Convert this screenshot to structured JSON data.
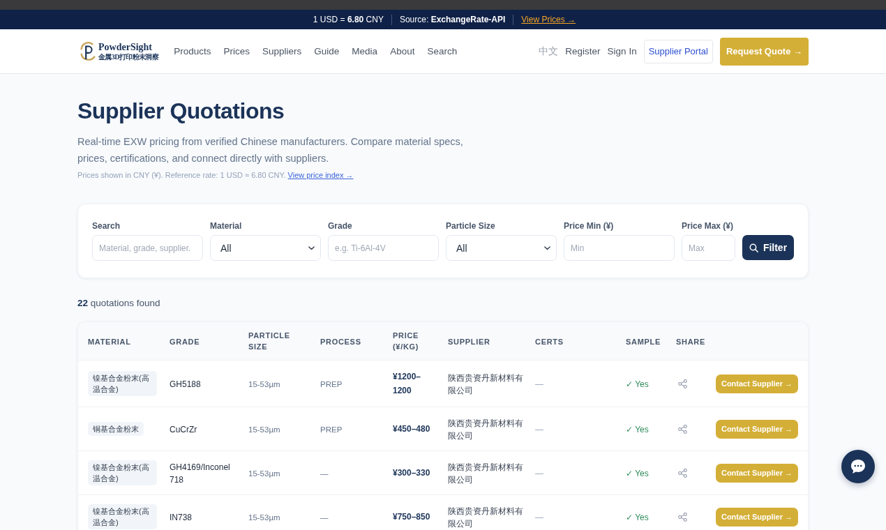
{
  "rate_bar": {
    "rate": "1 USD = **6.80** CNY",
    "source": "Source: **ExchangeRate-API**",
    "link": "View Prices →"
  },
  "header": {
    "logo": {
      "name": "PowderSight",
      "tagline": "金属3D打印粉末洞察"
    },
    "nav": [
      "Products",
      "Prices",
      "Suppliers",
      "Guide",
      "Media",
      "About",
      "Search"
    ],
    "language": "中文",
    "links": [
      "Register",
      "Sign In"
    ],
    "supplier_portal": "Supplier Portal",
    "request_quote": "Request Quote →"
  },
  "intro": {
    "title": "Supplier Quotations",
    "description": "Real-time EXW pricing from verified Chinese manufacturers. Compare material specs, prices, certifications, and connect directly with suppliers.",
    "note": "Prices shown in CNY (¥). Reference rate: 1 USD ≈ 6.80 CNY.",
    "note_link": "View price index →"
  },
  "filters": {
    "fields": [
      {
        "kind": "text",
        "label": "Search",
        "placeholder": "Material, grade, supplier."
      },
      {
        "kind": "select",
        "label": "Material",
        "value": "All"
      },
      {
        "kind": "text",
        "label": "Grade",
        "placeholder": "e.g. Ti-6Al-4V"
      },
      {
        "kind": "select",
        "label": "Particle Size",
        "value": "All"
      },
      {
        "kind": "text",
        "label": "Price Min (¥)",
        "placeholder": "Min"
      },
      {
        "kind": "text",
        "label": "Price Max (¥)",
        "placeholder": "Max"
      }
    ],
    "button": "Filter"
  },
  "results": {
    "count": "**22** quotations found"
  },
  "table": {
    "columns": [
      "MATERIAL",
      "GRADE",
      "PARTICLE SIZE",
      "PROCESS",
      "PRICE (¥/KG)",
      "SUPPLIER",
      "CERTS",
      "SAMPLE",
      "SHARE"
    ],
    "rows": [
      {
        "material": "镍基合金粉末(高温合金)",
        "grade": "GH5188",
        "particle_size": "15-53µm",
        "process": "PREP",
        "price": "¥1200–1200",
        "supplier": "陕西贵资丹新材料有限公司",
        "certs": "—",
        "sample": "✓ Yes",
        "action": "Contact Supplier →"
      },
      {
        "material": "铜基合金粉末",
        "grade": "CuCrZr",
        "particle_size": "15-53µm",
        "process": "PREP",
        "price": "¥450–480",
        "supplier": "陕西贵资丹新材料有限公司",
        "certs": "—",
        "sample": "✓ Yes",
        "action": "Contact Supplier →"
      },
      {
        "material": "镍基合金粉末(高温合金)",
        "grade": "GH4169/Inconel 718",
        "particle_size": "15-53µm",
        "process": "—",
        "price": "¥300–330",
        "supplier": "陕西贵资丹新材料有限公司",
        "certs": "—",
        "sample": "✓ Yes",
        "action": "Contact Supplier →"
      },
      {
        "material": "镍基合金粉末(高温合金)",
        "grade": "IN738",
        "particle_size": "15-53µm",
        "process": "—",
        "price": "¥750–850",
        "supplier": "陕西贵资丹新材料有限公司",
        "certs": "—",
        "sample": "✓ Yes",
        "action": "Contact Supplier →"
      }
    ]
  }
}
